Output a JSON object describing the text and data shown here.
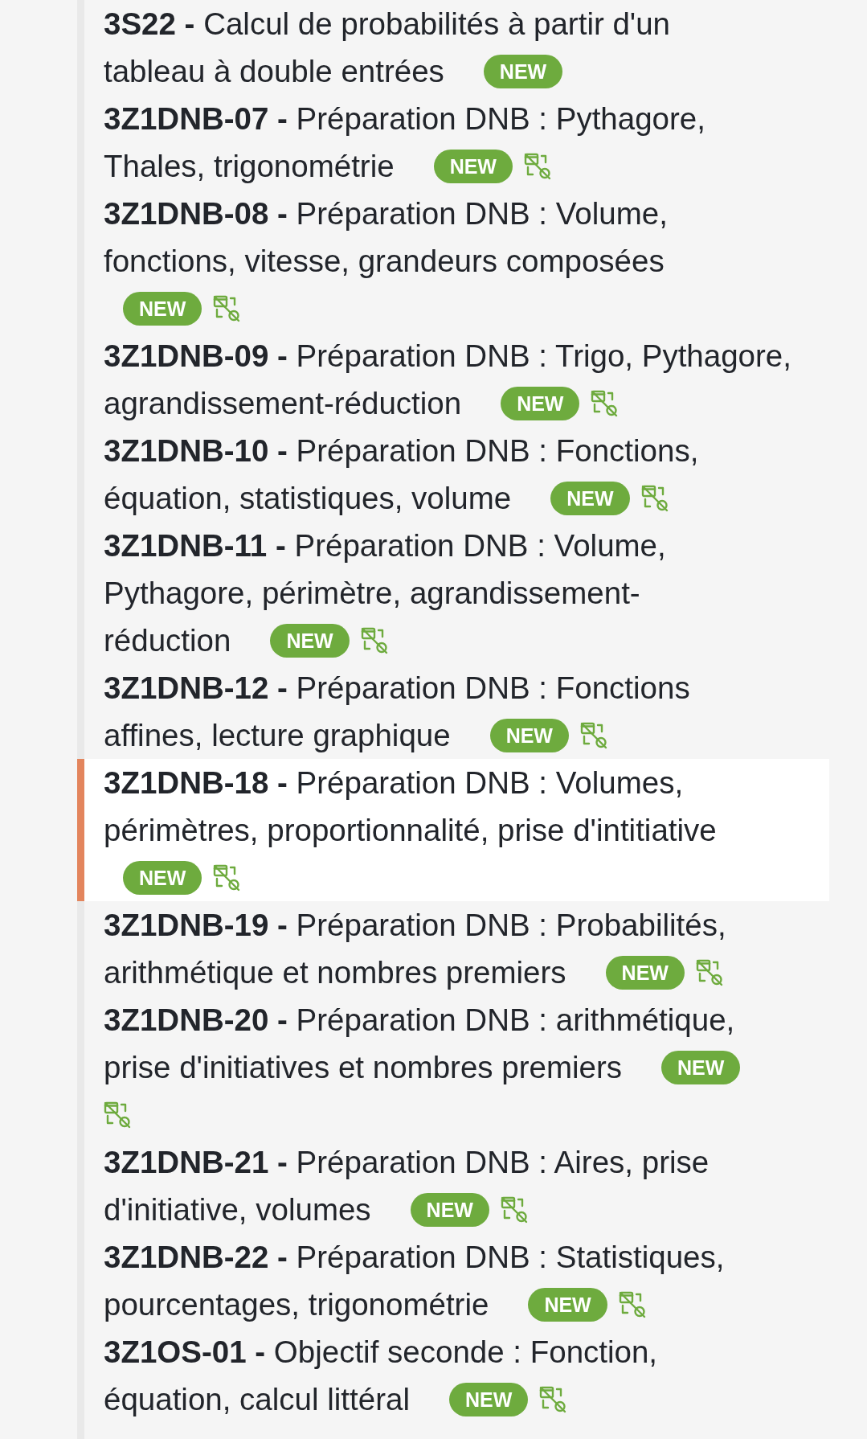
{
  "items": [
    {
      "lines": [
        "**3S22 -** Calcul de probabilités à partir d'un",
        "tableau à double entrées"
      ],
      "badge": "NEW",
      "has_icon": false,
      "selected": false
    },
    {
      "lines": [
        "**3Z1DNB-07 -** Préparation DNB : Pythagore,",
        "Thales, trigonométrie"
      ],
      "badge": "NEW",
      "has_icon": true,
      "selected": false
    },
    {
      "lines": [
        "**3Z1DNB-08 -** Préparation DNB : Volume,",
        "fonctions, vitesse, grandeurs composées"
      ],
      "badge": "NEW",
      "has_icon": true,
      "selected": false
    },
    {
      "lines": [
        "**3Z1DNB-09 -** Préparation DNB : Trigo, Pythagore,",
        "agrandissement-réduction"
      ],
      "badge": "NEW",
      "has_icon": true,
      "selected": false
    },
    {
      "lines": [
        "**3Z1DNB-10 -** Préparation DNB : Fonctions,",
        "équation, statistiques, volume"
      ],
      "badge": "NEW",
      "has_icon": true,
      "selected": false
    },
    {
      "lines": [
        "**3Z1DNB-11 -** Préparation DNB : Volume,",
        "Pythagore, périmètre, agrandissement-",
        "réduction"
      ],
      "badge": "NEW",
      "has_icon": true,
      "selected": false
    },
    {
      "lines": [
        "**3Z1DNB-12 -** Préparation DNB : Fonctions",
        "affines, lecture graphique"
      ],
      "badge": "NEW",
      "has_icon": true,
      "selected": false
    },
    {
      "lines": [
        "**3Z1DNB-18 -** Préparation DNB : Volumes,",
        "périmètres, proportionnalité, prise d'intitiative"
      ],
      "badge": "NEW",
      "has_icon": true,
      "selected": true
    },
    {
      "lines": [
        "**3Z1DNB-19 -** Préparation DNB : Probabilités,",
        "arithmétique et nombres premiers"
      ],
      "badge": "NEW",
      "has_icon": true,
      "selected": false
    },
    {
      "lines": [
        "**3Z1DNB-20 -** Préparation DNB : arithmétique,",
        "prise d'initiatives et nombres premiers"
      ],
      "badge": "NEW",
      "has_icon": true,
      "selected": false
    },
    {
      "lines": [
        "**3Z1DNB-21 -** Préparation DNB : Aires, prise",
        "d'initiative, volumes"
      ],
      "badge": "NEW",
      "has_icon": true,
      "selected": false
    },
    {
      "lines": [
        "**3Z1DNB-22 -** Préparation DNB : Statistiques,",
        "pourcentages, trigonométrie"
      ],
      "badge": "NEW",
      "has_icon": true,
      "selected": false
    },
    {
      "lines": [
        "**3Z1OS-01 -** Objectif seconde : Fonction,",
        "équation, calcul littéral"
      ],
      "badge": "NEW",
      "has_icon": true,
      "selected": false
    }
  ]
}
